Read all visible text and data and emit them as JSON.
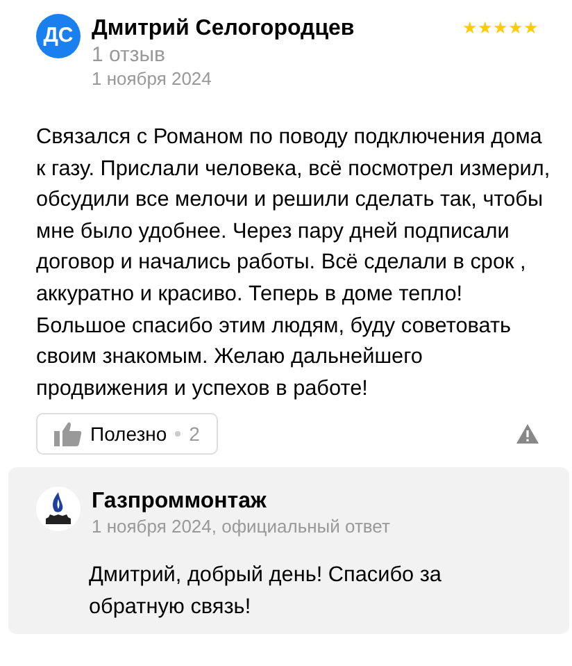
{
  "review": {
    "avatar_initials": "ДС",
    "author": "Дмитрий Селогородцев",
    "stars": 5,
    "reviews_count": "1 отзыв",
    "date": "1 ноября 2024",
    "text": "Связался с Романом по поводу подключения дома к газу. Прислали человека, всё посмотрел измерил, обсудили все мелочи и решили сделать так, чтобы мне было удобнее. Через пару дней подписали договор и начались работы. Всё сделали в срок , аккуратно и красиво. Теперь в доме тепло! Большое спасибо этим людям, буду советовать своим знакомым. Желаю дальнейшего продвижения и успехов в работе!",
    "helpful": {
      "label": "Полезно",
      "count": "2"
    }
  },
  "reply": {
    "company": "Газпроммонтаж",
    "meta": "1 ноября 2024, официальный ответ",
    "text": "Дмитрий, добрый день! Спасибо за обратную связь!"
  }
}
